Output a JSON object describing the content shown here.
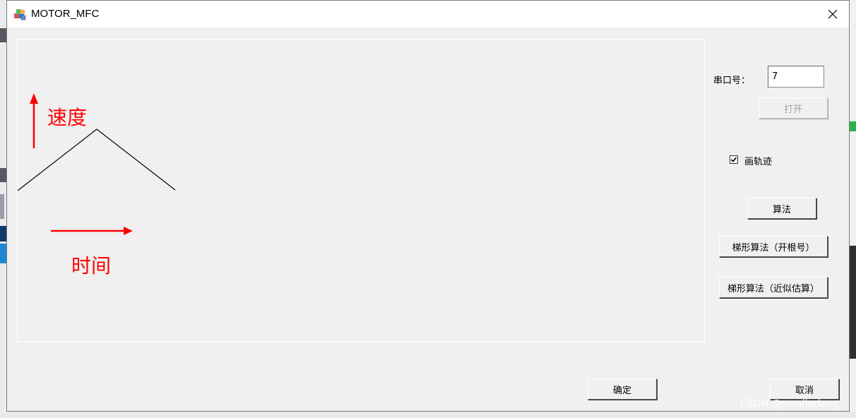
{
  "window": {
    "title": "MOTOR_MFC",
    "close_glyph": "✕"
  },
  "canvas": {
    "speed_label": "速度",
    "time_label": "时间",
    "arrow_color": "#ff0000",
    "line_color": "#000000"
  },
  "controls": {
    "serial_label": "串口号：",
    "serial_value": "7",
    "open_label": "打开",
    "draw_track_label": "画轨迹",
    "draw_track_checked": true,
    "algorithm_label": "算法",
    "trapezoid_sqrt_label": "梯形算法（开根号）",
    "trapezoid_approx_label": "梯形算法（近似估算）",
    "ok_label": "确定",
    "cancel_label": "取消"
  },
  "watermark": "CSDN @smallerlang"
}
